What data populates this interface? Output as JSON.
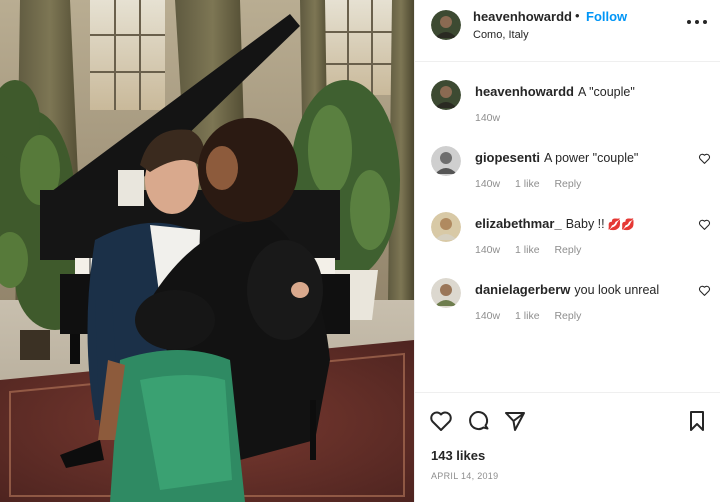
{
  "post": {
    "author": "heavenhowardd",
    "dot": "•",
    "follow_label": "Follow",
    "location": "Como, Italy",
    "more_icon": "more-horizontal-icon"
  },
  "comments": [
    {
      "user": "heavenhowardd",
      "text": "A \"couple\"",
      "time": "140w",
      "likes": "",
      "reply": ""
    },
    {
      "user": "giopesenti",
      "text": "A power \"couple\"",
      "time": "140w",
      "likes": "1 like",
      "reply": "Reply"
    },
    {
      "user": "elizabethmar_",
      "text": "Baby !!",
      "emoji": "💋💋",
      "time": "140w",
      "likes": "1 like",
      "reply": "Reply"
    },
    {
      "user": "danielagerberw",
      "text": "you look unreal",
      "time": "140w",
      "likes": "1 like",
      "reply": "Reply"
    }
  ],
  "actions": {
    "like_icon": "heart-icon",
    "comment_icon": "comment-icon",
    "share_icon": "share-icon",
    "save_icon": "bookmark-icon"
  },
  "likes": "143 likes",
  "date": "APRIL 14, 2019",
  "colors": {
    "accent": "#0095f6",
    "text": "#262626",
    "muted": "#8e8e8e",
    "border": "#efefef"
  }
}
